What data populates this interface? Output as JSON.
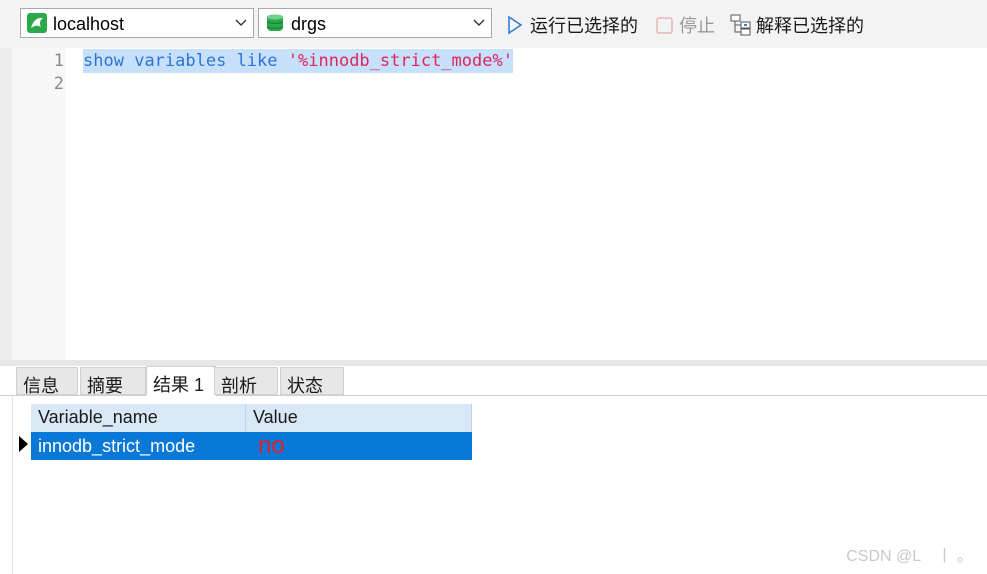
{
  "toolbar": {
    "connection": "localhost",
    "database": "drgs",
    "run_selected_label": "运行已选择的",
    "stop_label": "停止",
    "explain_selected_label": "解释已选择的"
  },
  "editor": {
    "line_numbers": [
      "1",
      "2"
    ],
    "code": {
      "kw1": "show",
      "kw2": "variables",
      "kw3": "like",
      "str": "'%innodb_strict_mode%'"
    }
  },
  "tabs": [
    {
      "label": "信息"
    },
    {
      "label": "摘要"
    },
    {
      "label": "结果 1"
    },
    {
      "label": "剖析"
    },
    {
      "label": "状态"
    }
  ],
  "results": {
    "columns": [
      "Variable_name",
      "Value"
    ],
    "rows": [
      {
        "variable_name": "innodb_strict_mode",
        "value": "no"
      }
    ]
  },
  "watermark": "CSDN @L　丨 。",
  "colors": {
    "selection": "#0a78d7",
    "keyword": "#2e74d6",
    "string": "#e0245e",
    "value_text": "#e0202a"
  }
}
